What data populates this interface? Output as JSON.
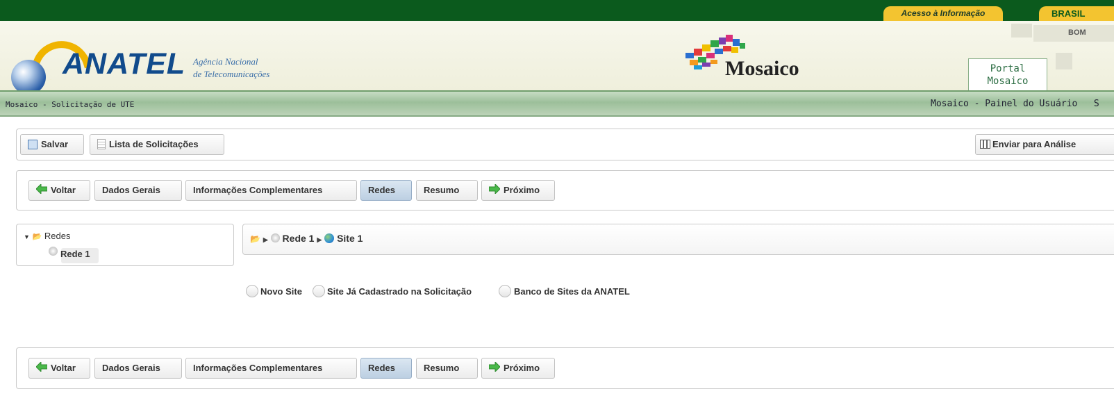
{
  "gov_bar": {
    "acesso_label": "Acesso à Informação",
    "brasil_label": "BRASIL",
    "bom_label": "BOM"
  },
  "header": {
    "logo_text": "ANATEL",
    "agency_line1": "Agência Nacional",
    "agency_line2": "de Telecomunicações",
    "app_title": "Mosaico",
    "portal_tab_line1": "Portal",
    "portal_tab_line2": "Mosaico"
  },
  "nav": {
    "left_title": "Mosaico - Solicitação de UTE",
    "right_link": "Mosaico - Painel do Usuário",
    "right_more": "S"
  },
  "toolbar": {
    "save_label": "Salvar",
    "list_label": "Lista de Solicitações",
    "send_label": "Enviar para Análise"
  },
  "wizard": {
    "back": "Voltar",
    "steps": [
      "Dados Gerais",
      "Informações Complementares",
      "Redes",
      "Resumo"
    ],
    "active_step": "Redes",
    "next": "Próximo"
  },
  "tree": {
    "root": "Redes",
    "child": "Rede 1"
  },
  "breadcrumb": {
    "rede": "Rede 1",
    "site": "Site 1"
  },
  "site_options": {
    "options": [
      "Novo Site",
      "Site Já Cadastrado na Solicitação",
      "Banco de Sites da ANATEL"
    ]
  },
  "colors": {
    "gov_green": "#0b5a1d",
    "gov_yellow": "#f3c430",
    "active_step_bg": "#c7d8ea"
  }
}
